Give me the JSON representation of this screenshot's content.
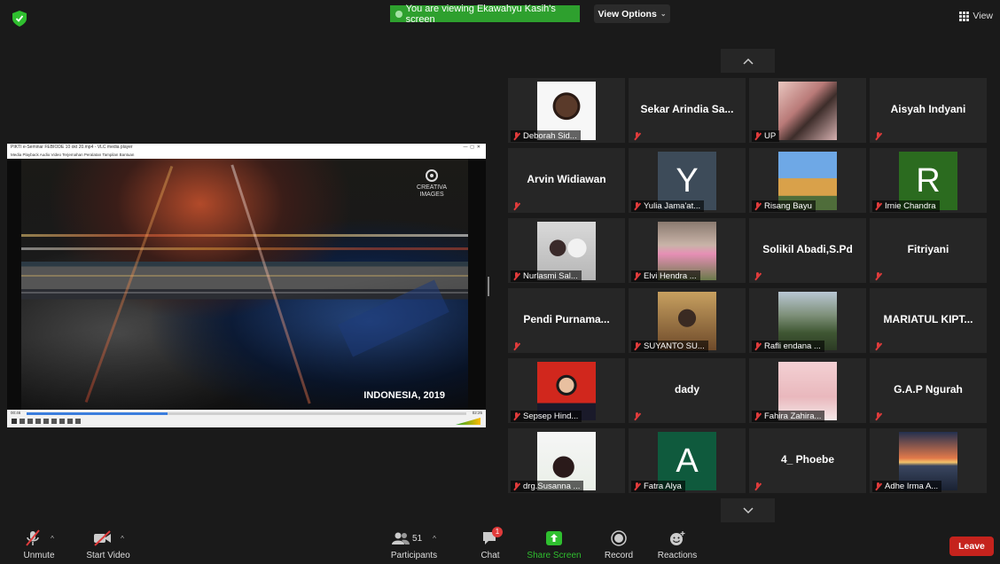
{
  "top": {
    "banner": "You are viewing Ekawahyu Kasih's screen",
    "view_options": "View Options",
    "view": "View"
  },
  "shared_screen": {
    "window_title": "PIKTI e-Seminar FEBIODE 10 okt 20.mp4 - VLC media player",
    "menu": "Media  Playback  Audio  Video  Terjemahan  Peralatan  Tampilan  Bantuan",
    "watermark_line1": "CREATIVA",
    "watermark_line2": "IMAGES",
    "caption": "INDONESIA, 2019",
    "time_elapsed": "00:46",
    "time_total": "02:25",
    "progress": 0.32
  },
  "participants_grid": [
    {
      "name": "Deborah Sid...",
      "type": "video",
      "img": "photo-girl"
    },
    {
      "name": "Sekar  Arindia  Sa...",
      "type": "name"
    },
    {
      "name": "UP",
      "type": "video",
      "img": "photo-family"
    },
    {
      "name": "Aisyah Indyani",
      "type": "name"
    },
    {
      "name": "Arvin Widiawan",
      "type": "name"
    },
    {
      "name": "Yulia Jama'at...",
      "type": "letter",
      "letter": "Y",
      "color": "#3d4b59"
    },
    {
      "name": "Risang Bayu",
      "type": "video",
      "img": "photo-letters"
    },
    {
      "name": "Irnie Chandra",
      "type": "letter",
      "letter": "R",
      "color": "#2b6b1f"
    },
    {
      "name": "Nurlasmi Sal...",
      "type": "video",
      "img": "photo-women"
    },
    {
      "name": "Elvi Hendra ...",
      "type": "video",
      "img": "photo-outdoor"
    },
    {
      "name": "Solikil Abadi,S.Pd",
      "type": "name"
    },
    {
      "name": "Fitriyani",
      "type": "name"
    },
    {
      "name": "Pendi  Purnama...",
      "type": "name"
    },
    {
      "name": "SUYANTO SU...",
      "type": "video",
      "img": "photo-man"
    },
    {
      "name": "Rafli endana ...",
      "type": "video",
      "img": "photo-landscape"
    },
    {
      "name": "MARIATUL KIPT...",
      "type": "name"
    },
    {
      "name": "Sepsep Hind...",
      "type": "video",
      "img": "photo-redman"
    },
    {
      "name": "dady",
      "type": "name"
    },
    {
      "name": "Fahira Zahira...",
      "type": "video",
      "img": "photo-pink"
    },
    {
      "name": "G.A.P Ngurah",
      "type": "name"
    },
    {
      "name": "drg.Susanna ...",
      "type": "video",
      "img": "photo-poster"
    },
    {
      "name": "Fatra Alya",
      "type": "letter",
      "letter": "A",
      "color": "#0f5a3d"
    },
    {
      "name": "4_ Phoebe",
      "type": "name"
    },
    {
      "name": "Adhe Irma A...",
      "type": "video",
      "img": "photo-sunset"
    }
  ],
  "toolbar": {
    "unmute": "Unmute",
    "start_video": "Start Video",
    "participants": "Participants",
    "participants_count": "51",
    "chat": "Chat",
    "chat_badge": "1",
    "share_screen": "Share Screen",
    "record": "Record",
    "reactions": "Reactions",
    "leave": "Leave"
  }
}
